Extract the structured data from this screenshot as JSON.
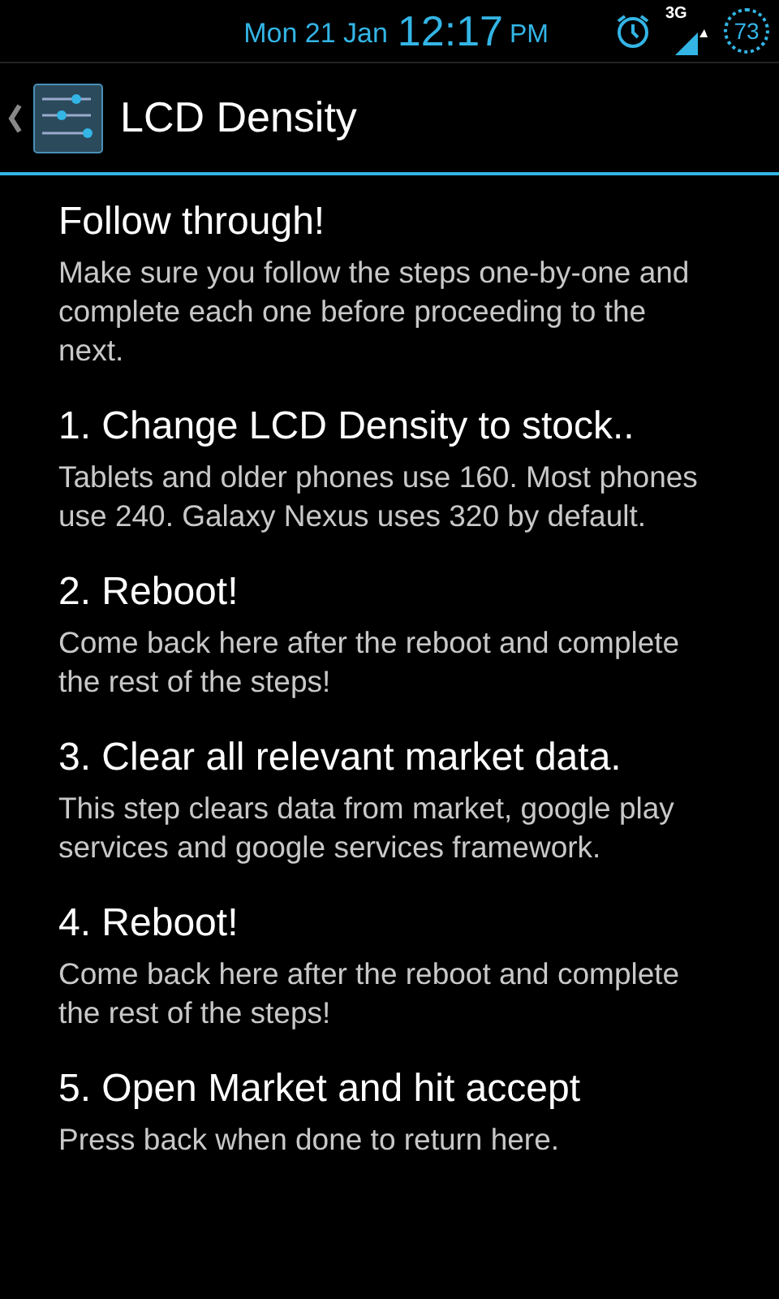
{
  "status_bar": {
    "date": "Mon 21 Jan",
    "time": "12:17",
    "ampm": "PM",
    "network": "3G",
    "battery": "73"
  },
  "action_bar": {
    "title": "LCD Density"
  },
  "sections": [
    {
      "title": "Follow through!",
      "body": "Make sure you follow the steps one-by-one and complete each one before proceeding to the next."
    },
    {
      "title": "1. Change LCD Density to stock..",
      "body": "Tablets and older phones use 160. Most phones use 240. Galaxy Nexus uses 320 by default."
    },
    {
      "title": "2. Reboot!",
      "body": "Come back here after the reboot and complete the rest of the steps!"
    },
    {
      "title": "3. Clear all relevant market data.",
      "body": "This step clears data from market, google play services and google services framework."
    },
    {
      "title": "4. Reboot!",
      "body": "Come back here after the reboot and complete the rest of the steps!"
    },
    {
      "title": "5. Open Market and hit accept",
      "body": "Press back when done to return here."
    }
  ]
}
